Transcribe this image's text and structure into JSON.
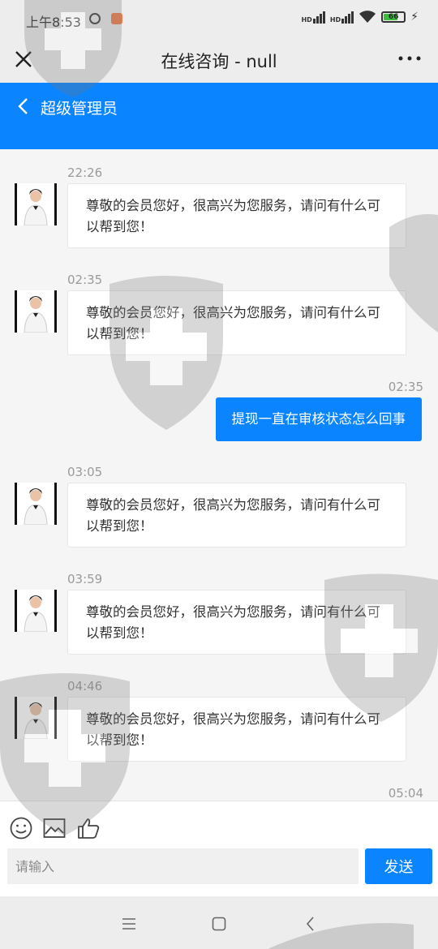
{
  "status_bar": {
    "time": "上午8:53",
    "signal_1": "HD",
    "signal_2": "HD",
    "battery": "66"
  },
  "title_bar": {
    "title": "在线咨询 - null"
  },
  "header": {
    "title": "超级管理员"
  },
  "messages": [
    {
      "side": "left",
      "time": "22:26",
      "text": "尊敬的会员您好，很高兴为您服务，请问有什么可以帮到您！"
    },
    {
      "side": "left",
      "time": "02:35",
      "text": "尊敬的会员您好，很高兴为您服务，请问有什么可以帮到您！"
    },
    {
      "side": "right",
      "time": "02:35",
      "text": "提现一直在审核状态怎么回事"
    },
    {
      "side": "left",
      "time": "03:05",
      "text": "尊敬的会员您好，很高兴为您服务，请问有什么可以帮到您！"
    },
    {
      "side": "left",
      "time": "03:59",
      "text": "尊敬的会员您好，很高兴为您服务，请问有什么可以帮到您！"
    },
    {
      "side": "left",
      "time": "04:46",
      "text": "尊敬的会员您好，很高兴为您服务，请问有什么可以帮到您！"
    },
    {
      "side": "right",
      "time": "05:04",
      "text": ""
    }
  ],
  "input": {
    "placeholder": "请输入",
    "send_label": "发送"
  },
  "colors": {
    "accent": "#0a84ff",
    "background": "#f5f5f5",
    "bars": "#ededed"
  },
  "icons": [
    "close-icon",
    "more-icon",
    "back-icon",
    "emoji-icon",
    "image-icon",
    "like-icon",
    "menu-icon",
    "home-icon",
    "back-nav-icon"
  ]
}
